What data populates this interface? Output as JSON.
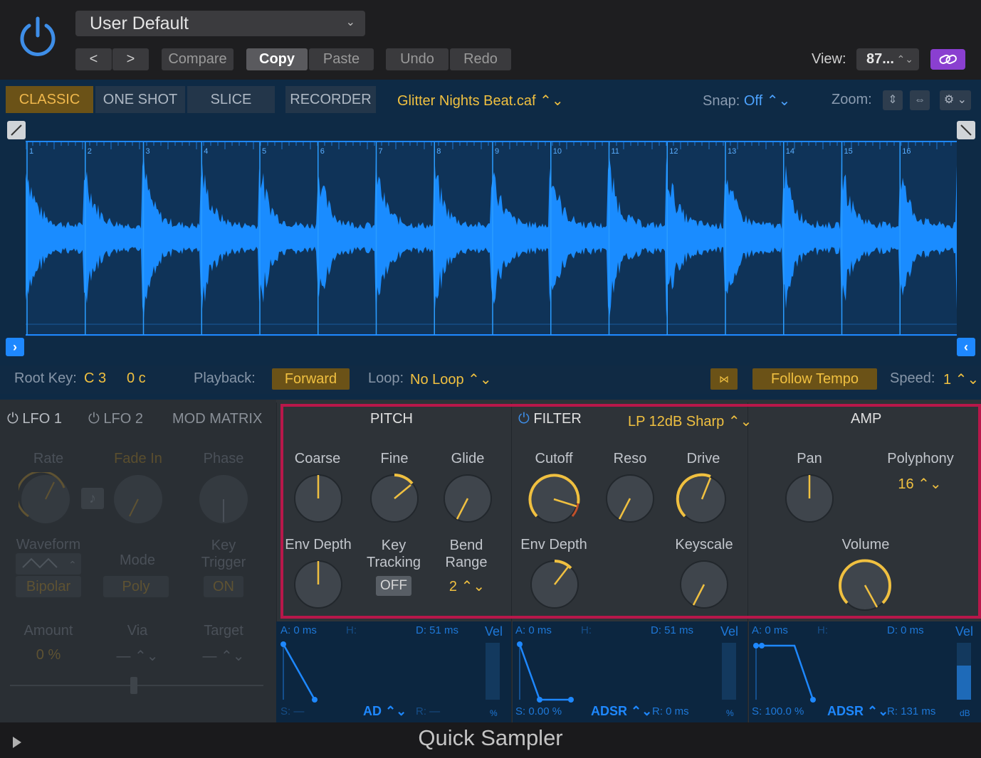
{
  "header": {
    "preset": "User Default",
    "prev_label": "<",
    "next_label": ">",
    "compare": "Compare",
    "copy": "Copy",
    "paste": "Paste",
    "undo": "Undo",
    "redo": "Redo",
    "view_label": "View:",
    "view_value": "87..."
  },
  "modes": {
    "classic": "CLASSIC",
    "one_shot": "ONE SHOT",
    "slice": "SLICE",
    "recorder": "RECORDER"
  },
  "sample": {
    "file": "Glitter Nights Beat.caf ⌃⌄",
    "snap_label": "Snap:",
    "snap_value": "Off ⌃⌄",
    "zoom_label": "Zoom:",
    "marker_numbers": [
      "1",
      "2",
      "3",
      "4",
      "5",
      "6",
      "7",
      "8",
      "9",
      "10",
      "11",
      "12",
      "13",
      "14",
      "15",
      "16"
    ]
  },
  "params": {
    "root_key_label": "Root Key:",
    "root_key": "C 3",
    "cents": "0 c",
    "playback_label": "Playback:",
    "playback": "Forward",
    "loop_label": "Loop:",
    "loop": "No Loop ⌃⌄",
    "follow_tempo": "Follow Tempo",
    "speed_label": "Speed:",
    "speed": "1 ⌃⌄"
  },
  "lfo": {
    "tab1": "LFO 1",
    "tab2": "LFO 2",
    "tab3": "MOD MATRIX",
    "rate": "Rate",
    "fade_in": "Fade In",
    "phase": "Phase",
    "waveform": "Waveform",
    "mode": "Mode",
    "key_trigger": "Key\nTrigger",
    "bipolar": "Bipolar",
    "poly": "Poly",
    "on": "ON",
    "amount": "Amount",
    "via": "Via",
    "target": "Target",
    "amount_val": "0 %",
    "via_val": "— ⌃⌄",
    "target_val": "— ⌃⌄"
  },
  "pitch": {
    "title": "PITCH",
    "coarse": "Coarse",
    "fine": "Fine",
    "glide": "Glide",
    "env_depth": "Env Depth",
    "key_tracking": "Key\nTracking",
    "key_tracking_value": "OFF",
    "bend_range": "Bend\nRange",
    "bend_range_value": "2 ⌃⌄"
  },
  "filter": {
    "title": "FILTER",
    "type": "LP 12dB Sharp ⌃⌄",
    "cutoff": "Cutoff",
    "reso": "Reso",
    "drive": "Drive",
    "env_depth": "Env Depth",
    "keyscale": "Keyscale"
  },
  "amp": {
    "title": "AMP",
    "pan": "Pan",
    "polyphony": "Polyphony",
    "polyphony_value": "16 ⌃⌄",
    "volume": "Volume"
  },
  "envelopes": [
    {
      "a": "A: 0 ms",
      "h": "H:",
      "d": "D: 51 ms",
      "vel": "Vel",
      "s": "S: —",
      "mode": "AD ⌃⌄",
      "r": "R: —",
      "unit": "%"
    },
    {
      "a": "A: 0 ms",
      "h": "H:",
      "d": "D: 51 ms",
      "vel": "Vel",
      "s": "S: 0.00 %",
      "mode": "ADSR ⌃⌄",
      "r": "R: 0 ms",
      "unit": "%"
    },
    {
      "a": "A: 0 ms",
      "h": "H:",
      "d": "D: 0 ms",
      "vel": "Vel",
      "s": "S: 100.0 %",
      "mode": "ADSR ⌃⌄",
      "r": "R: 131 ms",
      "unit": "dB"
    }
  ],
  "footer": {
    "title": "Quick Sampler"
  },
  "colors": {
    "accent": "#f0c040",
    "wave": "#1e88ff",
    "highlight": "#b8174a"
  }
}
